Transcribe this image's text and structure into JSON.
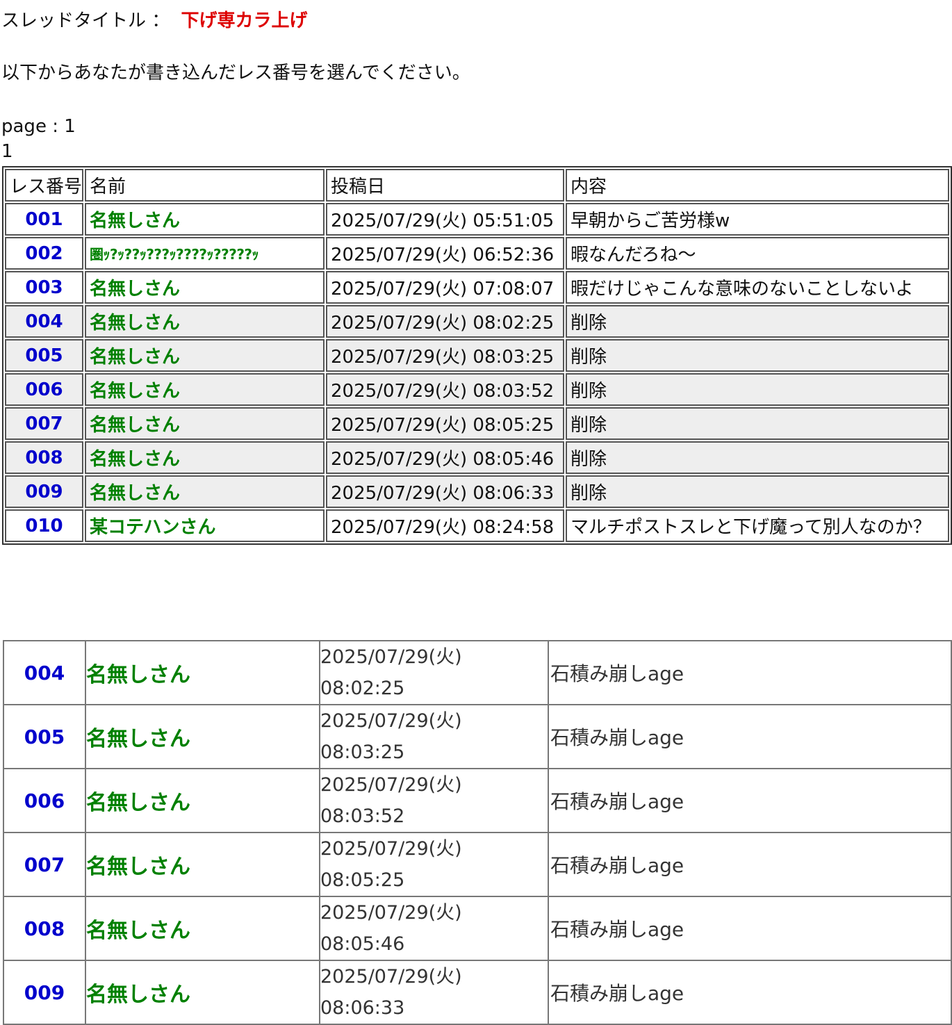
{
  "thread": {
    "label": "スレッドタイトル ：",
    "title": "下げ専カラ上げ"
  },
  "instruction": "以下からあなたが書き込んだレス番号を選んでください。",
  "page": {
    "label": "page : 1",
    "links": [
      "1"
    ]
  },
  "table": {
    "headers": [
      "レス番号",
      "名前",
      "投稿日",
      "内容"
    ],
    "rows": [
      {
        "num": "001",
        "name": "名無しさん",
        "date": "2025/07/29(火) 05:51:05",
        "content": "早朝からご苦労様w"
      },
      {
        "num": "002",
        "name": "圏ｯ?ｯ??ｯ???ｯ????ｯ?????ｯ",
        "date": "2025/07/29(火) 06:52:36",
        "content": "暇なんだろね～"
      },
      {
        "num": "003",
        "name": "名無しさん",
        "date": "2025/07/29(火) 07:08:07",
        "content": "暇だけじゃこんな意味のないことしないよ"
      },
      {
        "num": "004",
        "name": "名無しさん",
        "date": "2025/07/29(火) 08:02:25",
        "content": "削除"
      },
      {
        "num": "005",
        "name": "名無しさん",
        "date": "2025/07/29(火) 08:03:25",
        "content": "削除"
      },
      {
        "num": "006",
        "name": "名無しさん",
        "date": "2025/07/29(火) 08:03:52",
        "content": "削除"
      },
      {
        "num": "007",
        "name": "名無しさん",
        "date": "2025/07/29(火) 08:05:25",
        "content": "削除"
      },
      {
        "num": "008",
        "name": "名無しさん",
        "date": "2025/07/29(火) 08:05:46",
        "content": "削除"
      },
      {
        "num": "009",
        "name": "名無しさん",
        "date": "2025/07/29(火) 08:06:33",
        "content": "削除"
      },
      {
        "num": "010",
        "name": "某コテハンさん",
        "date": "2025/07/29(火) 08:24:58",
        "content": "マルチポストスレと下げ魔って別人なのか？"
      }
    ]
  },
  "details": [
    {
      "num": "004",
      "name": "名無しさん",
      "date_line1": "2025/07/29(火)",
      "date_line2": "08:02:25",
      "content": "石積み崩しage"
    },
    {
      "num": "005",
      "name": "名無しさん",
      "date_line1": "2025/07/29(火)",
      "date_line2": "08:03:25",
      "content": "石積み崩しage"
    },
    {
      "num": "006",
      "name": "名無しさん",
      "date_line1": "2025/07/29(火)",
      "date_line2": "08:03:52",
      "content": "石積み崩しage"
    },
    {
      "num": "007",
      "name": "名無しさん",
      "date_line1": "2025/07/29(火)",
      "date_line2": "08:05:25",
      "content": "石積み崩しage"
    },
    {
      "num": "008",
      "name": "名無しさん",
      "date_line1": "2025/07/29(火)",
      "date_line2": "08:05:46",
      "content": "石積み崩しage"
    },
    {
      "num": "009",
      "name": "名無しさん",
      "date_line1": "2025/07/29(火)",
      "date_line2": "08:06:33",
      "content": "石積み崩しage"
    }
  ],
  "colors": {
    "title": "#dd0000",
    "number": "#0000cc",
    "name": "#008000",
    "deleted_row_bg": "#eeeeee"
  }
}
